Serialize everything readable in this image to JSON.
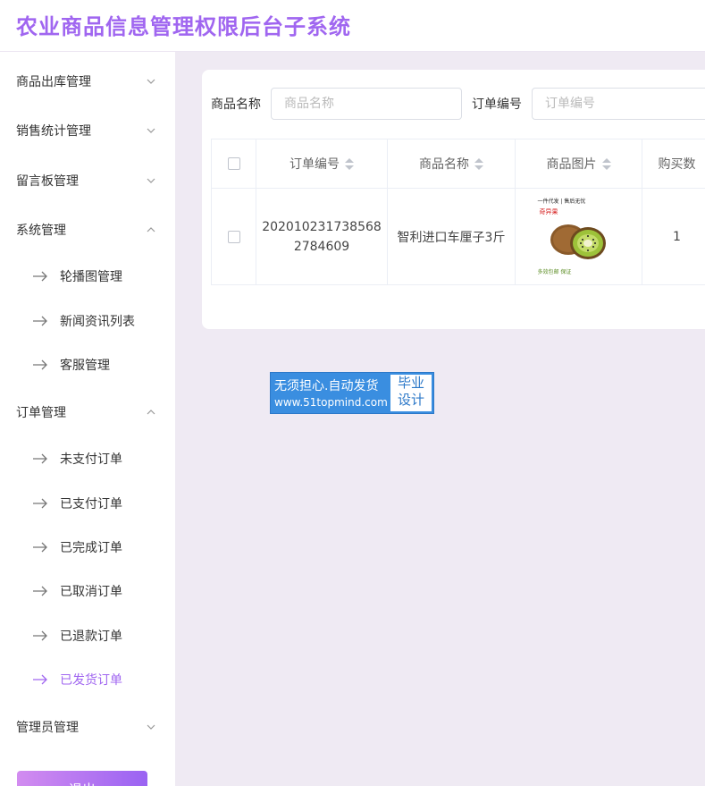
{
  "app": {
    "title": "农业商品信息管理权限后台子系统"
  },
  "sidebar": {
    "groups": [
      {
        "label": "商品出库管理",
        "expanded": false
      },
      {
        "label": "销售统计管理",
        "expanded": false
      },
      {
        "label": "留言板管理",
        "expanded": false
      },
      {
        "label": "系统管理",
        "expanded": true,
        "items": [
          "轮播图管理",
          "新闻资讯列表",
          "客服管理"
        ]
      },
      {
        "label": "订单管理",
        "expanded": true,
        "items": [
          "未支付订单",
          "已支付订单",
          "已完成订单",
          "已取消订单",
          "已退款订单",
          "已发货订单"
        ]
      },
      {
        "label": "管理员管理",
        "expanded": false
      }
    ],
    "active_item": "已发货订单",
    "logout_label": "退出"
  },
  "search": {
    "product_name_label": "商品名称",
    "product_name_placeholder": "商品名称",
    "product_name_value": "",
    "order_no_label": "订单编号",
    "order_no_placeholder": "订单编号",
    "order_no_value": ""
  },
  "table": {
    "columns": [
      "订单编号",
      "商品名称",
      "商品图片",
      "购买数"
    ],
    "rows": [
      {
        "order_no_line1": "202010231738568",
        "order_no_line2": "2784609",
        "product_name": "智利进口车厘子3斤",
        "image": {
          "banner": "一件代发 | 售后无忧",
          "tag": "奇异果",
          "footer": "多效包邮 保证"
        },
        "quantity": "1"
      }
    ]
  },
  "watermark": {
    "line1": "无须担心.自动发货",
    "line2": "www.51topmind.com",
    "badge1": "毕业",
    "badge2": "设计"
  },
  "colors": {
    "accent": "#a066f0",
    "background": "#efeaf3",
    "watermark": "#3a8ee0"
  },
  "icons": {
    "collapsed": "chevron-down-icon",
    "expanded": "chevron-up-icon",
    "subitem": "arrow-right-icon",
    "sort": "sort-icon"
  }
}
